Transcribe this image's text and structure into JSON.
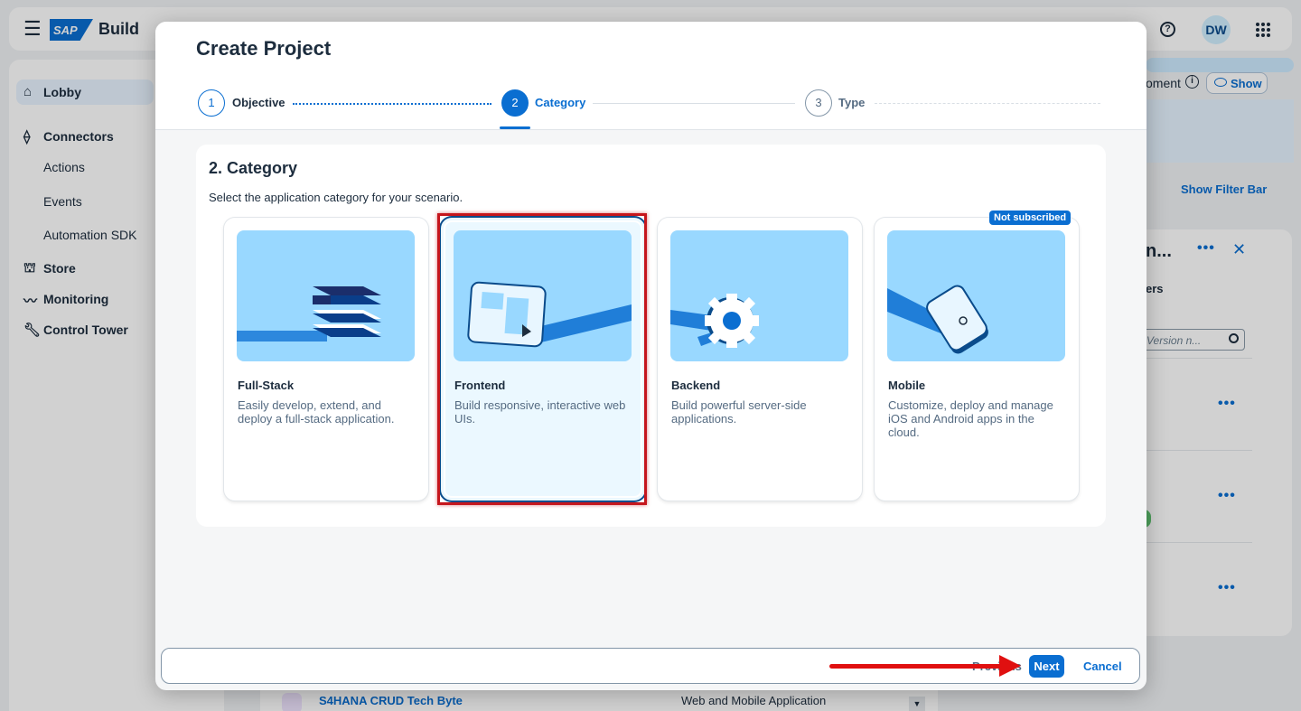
{
  "app": {
    "brand_logo": "SAP",
    "brand_name": "Build",
    "user_initials": "DW"
  },
  "sidebar": {
    "items": [
      {
        "label": "Lobby"
      },
      {
        "label": "Connectors"
      },
      {
        "label": "Actions"
      },
      {
        "label": "Events"
      },
      {
        "label": "Automation SDK"
      },
      {
        "label": "Store"
      },
      {
        "label": "Monitoring"
      },
      {
        "label": "Control Tower"
      }
    ]
  },
  "background": {
    "env_text": "oment",
    "show_label": "Show",
    "filter_label": "Show Filter Bar",
    "panel_title": "n...",
    "tab_text": "ers",
    "search_placeholder": "Version n...",
    "list_item_name": "S4HANA CRUD Tech Byte",
    "list_item_type": "Web and Mobile Application"
  },
  "dialog": {
    "title": "Create Project",
    "steps": [
      {
        "number": "1",
        "label": "Objective"
      },
      {
        "number": "2",
        "label": "Category"
      },
      {
        "number": "3",
        "label": "Type"
      }
    ],
    "section_title": "2. Category",
    "section_desc": "Select the application category for your scenario.",
    "cards": [
      {
        "title": "Full-Stack",
        "desc": "Easily develop, extend, and deploy a full-stack application."
      },
      {
        "title": "Frontend",
        "desc": "Build responsive, interactive web UIs."
      },
      {
        "title": "Backend",
        "desc": "Build powerful server-side applications."
      },
      {
        "title": "Mobile",
        "desc": "Customize, deploy and manage iOS and Android apps in the cloud.",
        "badge": "Not subscribed"
      }
    ],
    "footer": {
      "previous": "Previous",
      "next": "Next",
      "cancel": "Cancel"
    }
  },
  "colors": {
    "accent": "#0a6ed1",
    "highlight": "#c5161d",
    "arrow": "#e01010"
  }
}
